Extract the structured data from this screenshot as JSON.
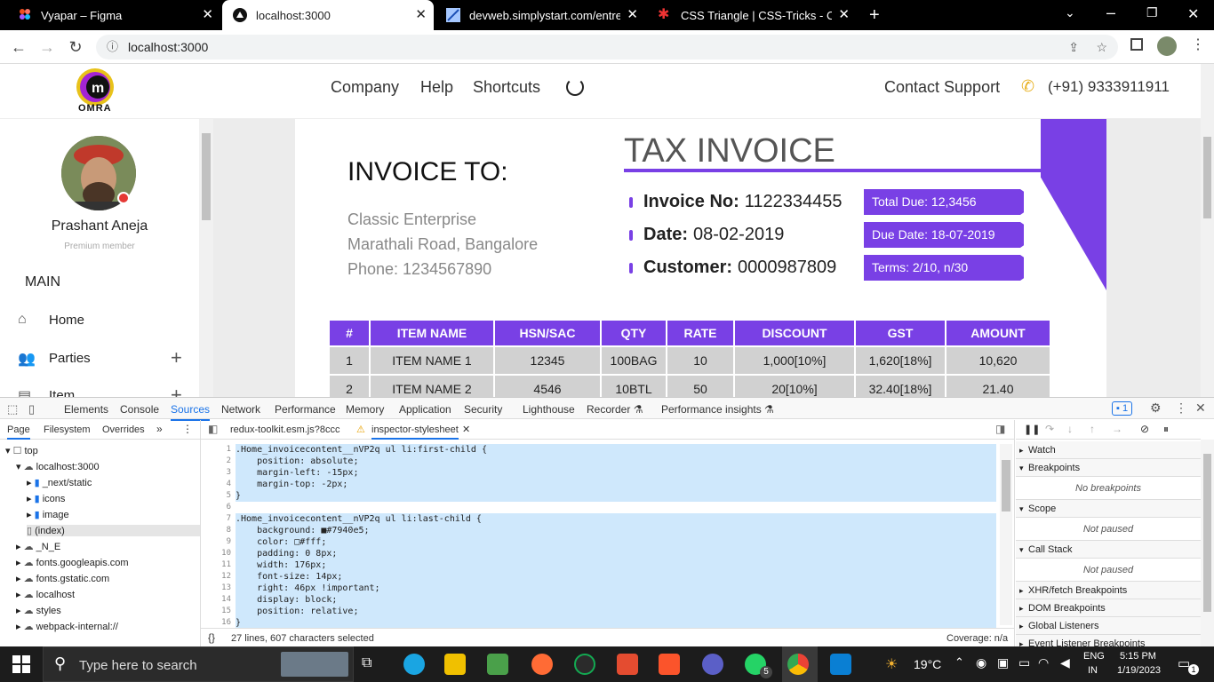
{
  "browser": {
    "tabs": [
      {
        "title": "Vyapar – Figma",
        "icon": "figma-icon",
        "active": false
      },
      {
        "title": "localhost:3000",
        "icon": "vercel-icon",
        "active": true
      },
      {
        "title": "devweb.simplystart.com/entrepre",
        "icon": "page-icon",
        "active": false
      },
      {
        "title": "CSS Triangle | CSS-Tricks - CSS-Tr",
        "icon": "csstricks-icon",
        "active": false
      }
    ],
    "url": "localhost:3000"
  },
  "app": {
    "logo_text": "OMRA",
    "nav": [
      "Company",
      "Help",
      "Shortcuts"
    ],
    "contact_label": "Contact Support",
    "contact_phone": "(+91) 9333911911"
  },
  "sidebar": {
    "user_name": "Prashant Aneja",
    "user_role": "Premium member",
    "section": "MAIN",
    "items": [
      {
        "label": "Home",
        "icon": "home-icon"
      },
      {
        "label": "Parties",
        "icon": "people-icon"
      },
      {
        "label": "Item",
        "icon": "item-icon"
      }
    ]
  },
  "invoice": {
    "to_heading": "INVOICE TO:",
    "company": "Classic Enterprise",
    "address": "Marathali Road, Bangalore",
    "phone": "Phone: 1234567890",
    "title": "TAX INVOICE",
    "details": [
      {
        "label": "Invoice No:",
        "value": "1122334455"
      },
      {
        "label": "Date:",
        "value": "08-02-2019"
      },
      {
        "label": "Customer:",
        "value": "0000987809"
      }
    ],
    "tags": [
      "Total Due: 12,3456",
      "Due Date: 18-07-2019",
      "Terms: 2/10, n/30"
    ],
    "columns": [
      "#",
      "ITEM NAME",
      "HSN/SAC",
      "QTY",
      "RATE",
      "DISCOUNT",
      "GST",
      "AMOUNT"
    ],
    "rows": [
      [
        "1",
        "ITEM NAME 1",
        "12345",
        "100BAG",
        "10",
        "1,000[10%]",
        "1,620[18%]",
        "10,620"
      ],
      [
        "2",
        "ITEM NAME 2",
        "4546",
        "10BTL",
        "50",
        "20[10%]",
        "32.40[18%]",
        "21.40"
      ]
    ]
  },
  "devtools": {
    "tabs": [
      "Elements",
      "Console",
      "Sources",
      "Network",
      "Performance",
      "Memory",
      "Application",
      "Security",
      "Lighthouse",
      "Recorder ⚗",
      "Performance insights ⚗"
    ],
    "active_tab": "Sources",
    "issues_count": "1",
    "nav_tabs": [
      "Page",
      "Filesystem",
      "Overrides"
    ],
    "tree": [
      {
        "label": "top",
        "indent": 0
      },
      {
        "label": "localhost:3000",
        "indent": 1
      },
      {
        "label": "_next/static",
        "indent": 2
      },
      {
        "label": "icons",
        "indent": 2
      },
      {
        "label": "image",
        "indent": 2
      },
      {
        "label": "(index)",
        "indent": 2
      },
      {
        "label": "_N_E",
        "indent": 1
      },
      {
        "label": "fonts.googleapis.com",
        "indent": 1
      },
      {
        "label": "fonts.gstatic.com",
        "indent": 1
      },
      {
        "label": "localhost",
        "indent": 1
      },
      {
        "label": "styles",
        "indent": 1
      },
      {
        "label": "webpack-internal://",
        "indent": 1
      }
    ],
    "file_tabs": [
      "redux-toolkit.esm.js?8ccc",
      "inspector-stylesheet"
    ],
    "code_lines": [
      ".Home_invoicecontent__nVP2q ul li:first-child {",
      "    position: absolute;",
      "    margin-left: -15px;",
      "    margin-top: -2px;",
      "}",
      "",
      ".Home_invoicecontent__nVP2q ul li:last-child {",
      "    background: ■#7940e5;",
      "    color: □#fff;",
      "    padding: 0 8px;",
      "    width: 176px;",
      "    font-size: 14px;",
      "    right: 46px !important;",
      "    display: block;",
      "    position: relative;",
      "}"
    ],
    "status_left": "27 lines, 607 characters selected",
    "status_right": "Coverage: n/a",
    "right_panel": [
      {
        "type": "section",
        "label": "Watch"
      },
      {
        "type": "section",
        "label": "Breakpoints"
      },
      {
        "type": "note",
        "label": "No breakpoints"
      },
      {
        "type": "section",
        "label": "Scope"
      },
      {
        "type": "note",
        "label": "Not paused"
      },
      {
        "type": "section",
        "label": "Call Stack"
      },
      {
        "type": "note",
        "label": "Not paused"
      },
      {
        "type": "section",
        "label": "XHR/fetch Breakpoints"
      },
      {
        "type": "section",
        "label": "DOM Breakpoints"
      },
      {
        "type": "section",
        "label": "Global Listeners"
      },
      {
        "type": "section",
        "label": "Event Listener Breakpoints"
      }
    ]
  },
  "taskbar": {
    "search_placeholder": "Type here to search",
    "weather": "19°C",
    "lang1": "ENG",
    "lang2": "IN",
    "time": "5:15 PM",
    "date": "1/19/2023",
    "whatsapp_badge": "5",
    "notification_count": "1"
  },
  "colors": {
    "accent": "#7940e5",
    "table_cell": "#d1d1d1"
  }
}
